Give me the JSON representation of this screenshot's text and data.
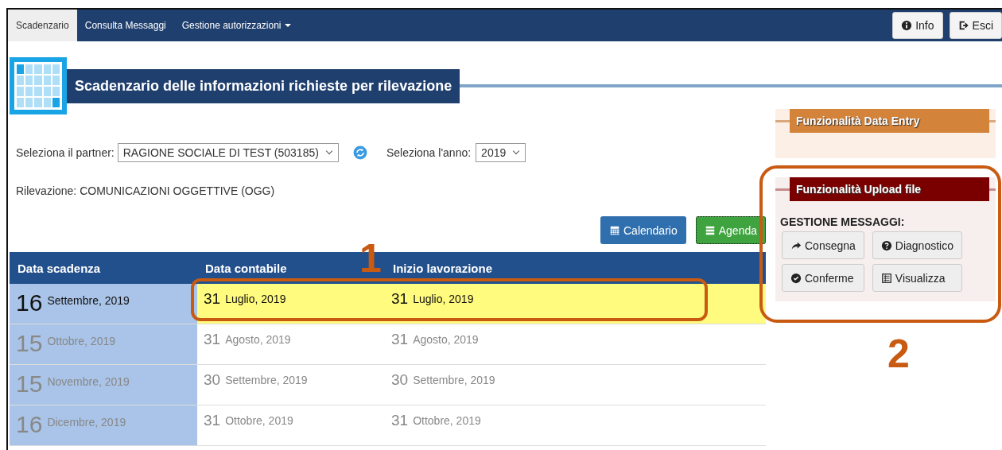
{
  "nav": {
    "tabs": [
      {
        "label": "Scadenzario",
        "selected": true,
        "dropdown": false
      },
      {
        "label": "Consulta Messaggi",
        "selected": false,
        "dropdown": false
      },
      {
        "label": "Gestione autorizzazioni",
        "selected": false,
        "dropdown": true
      }
    ],
    "buttons": [
      {
        "kind": "info",
        "label": "Info"
      },
      {
        "kind": "exit",
        "label": "Esci"
      }
    ]
  },
  "page_title": "Scadenzario delle informazioni richieste per rilevazione",
  "filters": {
    "partner_label": "Seleziona il partner:",
    "partner_value": "RAGIONE SOCIALE DI TEST (503185)",
    "year_label": "Seleziona l'anno:",
    "year_value": "2019"
  },
  "rilevazione": "Rilevazione: COMUNICAZIONI OGGETTIVE (OGG)",
  "view_buttons": [
    {
      "kind": "calendar",
      "label": "Calendario",
      "selected": false
    },
    {
      "kind": "agenda",
      "label": "Agenda",
      "selected": true
    }
  ],
  "table": {
    "columns": [
      "Data scadenza",
      "Data contabile",
      "Inizio lavorazione"
    ],
    "rows": [
      {
        "selected": true,
        "cells": [
          {
            "day": "16",
            "month": "Settembre, 2019"
          },
          {
            "day": "31",
            "month": "Luglio, 2019"
          },
          {
            "day": "31",
            "month": "Luglio, 2019"
          }
        ]
      },
      {
        "selected": false,
        "cells": [
          {
            "day": "15",
            "month": "Ottobre, 2019"
          },
          {
            "day": "31",
            "month": "Agosto, 2019"
          },
          {
            "day": "31",
            "month": "Agosto, 2019"
          }
        ]
      },
      {
        "selected": false,
        "cells": [
          {
            "day": "15",
            "month": "Novembre, 2019"
          },
          {
            "day": "30",
            "month": "Settembre, 2019"
          },
          {
            "day": "30",
            "month": "Settembre, 2019"
          }
        ]
      },
      {
        "selected": false,
        "cells": [
          {
            "day": "16",
            "month": "Dicembre, 2019"
          },
          {
            "day": "31",
            "month": "Ottobre, 2019"
          },
          {
            "day": "31",
            "month": "Ottobre, 2019"
          }
        ]
      }
    ]
  },
  "panels": [
    {
      "kind": "data_entry",
      "title": "Funzionalità Data Entry"
    },
    {
      "kind": "upload",
      "title": "Funzionalità Upload file",
      "subtitle": "GESTIONE MESSAGGI:",
      "buttons": [
        {
          "kind": "send",
          "label": "Consegna"
        },
        {
          "kind": "help",
          "label": "Diagnostico"
        },
        {
          "kind": "check",
          "label": "Conferme"
        },
        {
          "kind": "list",
          "label": "Visualizza"
        }
      ]
    }
  ],
  "annotations": [
    "1",
    "2"
  ]
}
